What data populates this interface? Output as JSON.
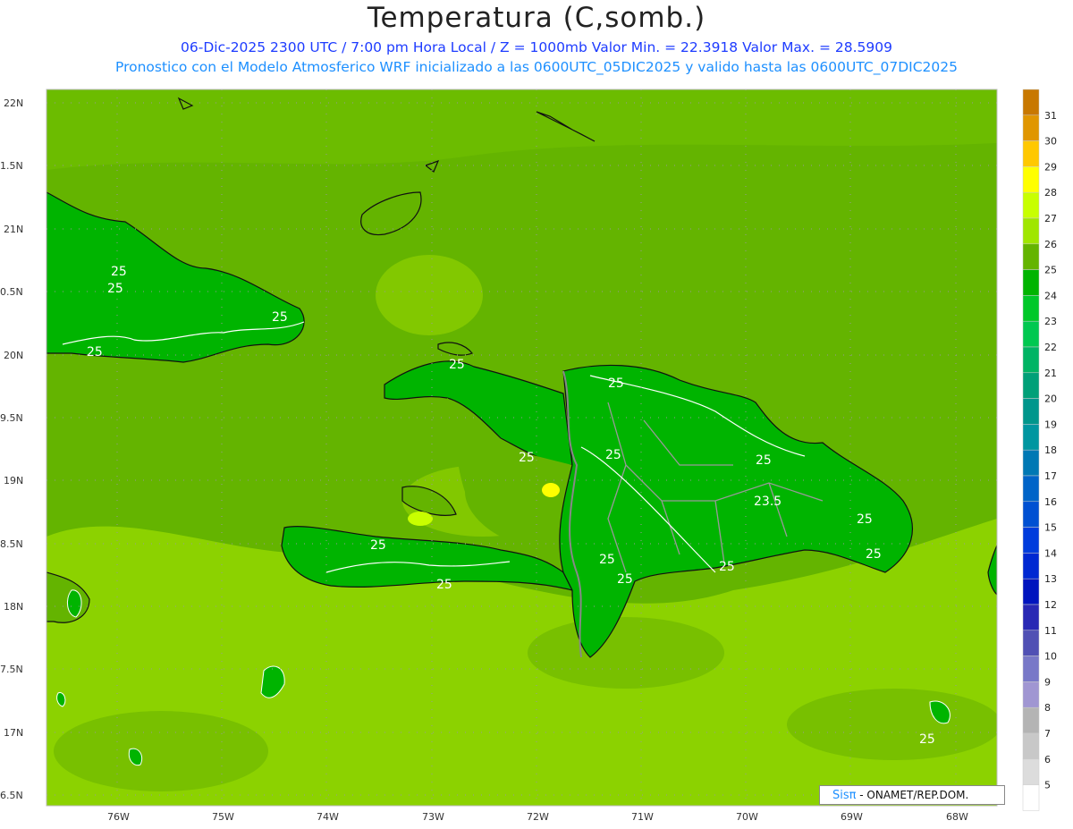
{
  "title": "Temperatura (C,somb.)",
  "subtitle1": "06-Dic-2025  2300 UTC / 7:00 pm Hora Local / Z = 1000mb    Valor Min. = 22.3918  Valor Max. = 28.5909",
  "subtitle2": "Pronostico con el Modelo Atmosferico WRF inicializado a las 0600UTC_05DIC2025 y valido hasta las  0600UTC_07DIC2025",
  "lat_labels": [
    "22N",
    "1.5N",
    "21N",
    "0.5N",
    "20N",
    "9.5N",
    "19N",
    "8.5N",
    "18N",
    "7.5N",
    "17N",
    "6.5N"
  ],
  "lon_labels": [
    "76W",
    "75W",
    "74W",
    "73W",
    "72W",
    "71W",
    "70W",
    "69W",
    "68W"
  ],
  "colorbar": {
    "labels": [
      "31",
      "30",
      "29",
      "28",
      "27",
      "26",
      "25",
      "24",
      "23",
      "22",
      "21",
      "20",
      "19",
      "18",
      "17",
      "16",
      "15",
      "14",
      "13",
      "12",
      "11",
      "10",
      "9",
      "8",
      "7",
      "6",
      "5"
    ],
    "colors": [
      "#c87800",
      "#e09600",
      "#ffc800",
      "#ffff00",
      "#c8ff00",
      "#a0e600",
      "#64b400",
      "#00b400",
      "#00c828",
      "#00c850",
      "#00b464",
      "#00a078",
      "#00968c",
      "#0096a0",
      "#0078b4",
      "#0064c8",
      "#0050d2",
      "#003cdc",
      "#0028d2",
      "#0014be",
      "#2828b4",
      "#5050b4",
      "#7878c8",
      "#a096d2",
      "#b4b4b4",
      "#c8c8c8",
      "#dcdcdc",
      "#ffffff"
    ]
  },
  "contour_labels": [
    "25",
    "25",
    "25",
    "25",
    "25",
    "25",
    "25",
    "25",
    "25",
    "25",
    "23.5",
    "25",
    "25",
    "25",
    "25",
    "25",
    "25",
    "25"
  ],
  "credit": {
    "brand": "Sisπ",
    "org": " - ONAMET/REP.DOM."
  }
}
